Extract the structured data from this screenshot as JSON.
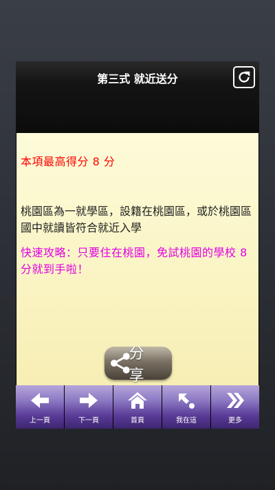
{
  "header": {
    "title": "第三式 就近送分"
  },
  "content": {
    "max_score": "本項最高得分 8 分",
    "description": "桃園區為一就學區，設籍在桃園區，或於桃園區國中就讀皆符合就近入學",
    "tip": "快速攻略：只要住在桃園，免試桃園的學校 8 分就到手啦！"
  },
  "share": {
    "label": "分 享"
  },
  "nav": {
    "items": [
      {
        "label": "上一頁",
        "icon": "arrow-left-icon"
      },
      {
        "label": "下一頁",
        "icon": "arrow-right-icon"
      },
      {
        "label": "首頁",
        "icon": "home-icon"
      },
      {
        "label": "我在這",
        "icon": "location-arrow-icon"
      },
      {
        "label": "更多",
        "icon": "double-chevron-right-icon"
      }
    ]
  },
  "colors": {
    "score_red": "#ff0000",
    "tip_magenta": "#e300e3",
    "content_bg": "#fcf7c9",
    "nav_purple": "#5a3b97"
  }
}
